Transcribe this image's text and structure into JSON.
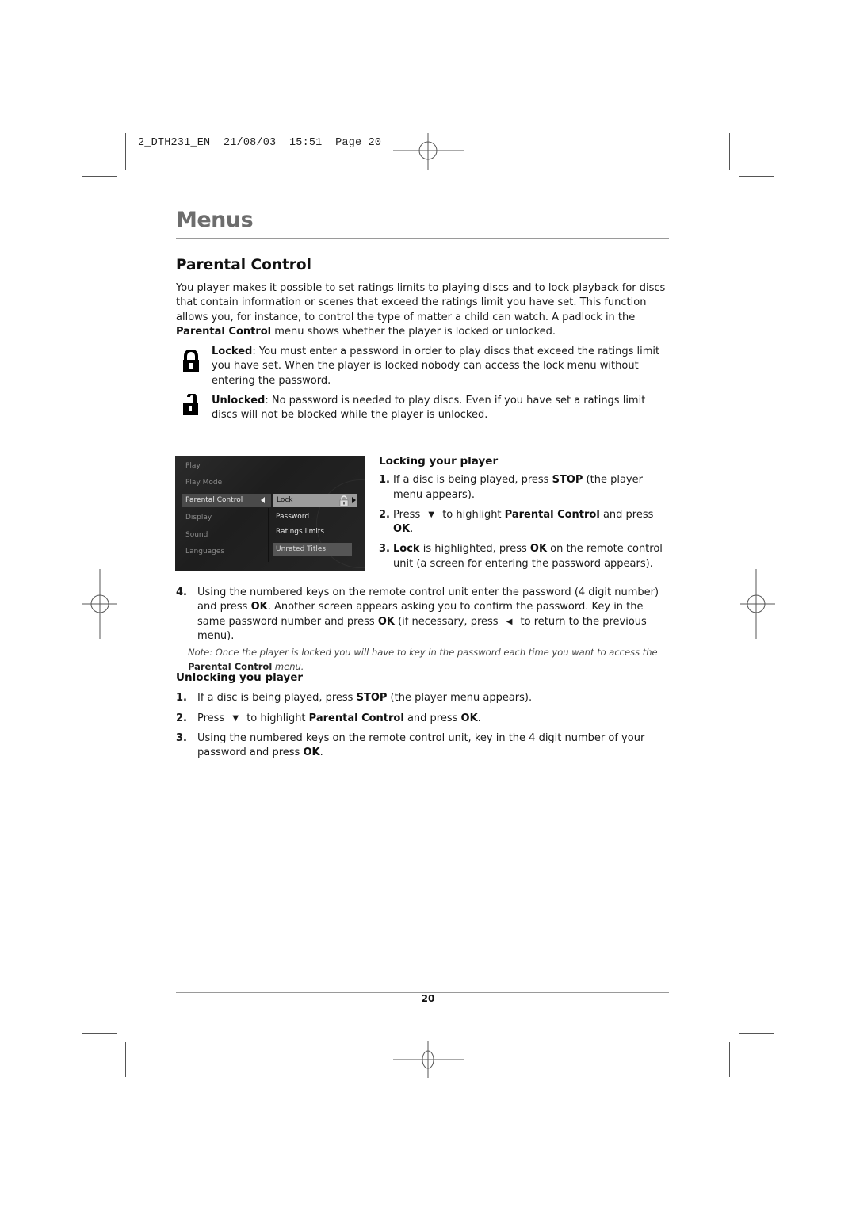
{
  "slug": {
    "file": "2_DTH231_EN",
    "date": "21/08/03",
    "time": "15:51",
    "page_label": "Page 20"
  },
  "section_title": "Menus",
  "heading": "Parental Control",
  "intro": {
    "t1": "You player makes it possible to set ratings limits to playing discs and to lock playback for discs that contain information or scenes that exceed the ratings limit you have set. This function allows you, for instance, to control the type of matter a child can watch. A padlock in the ",
    "b1": "Parental Control",
    "t2": " menu shows whether the player is locked or unlocked."
  },
  "locked": {
    "icon": "padlock-closed-icon",
    "label": "Locked",
    "text": ": You must enter a password in order to play discs that exceed the ratings limit you have set. When the player is locked nobody can access the lock menu without entering the password."
  },
  "unlocked": {
    "icon": "padlock-open-icon",
    "label": "Unlocked",
    "text": ": No password is needed to play discs. Even if you have set a ratings limit discs will not be blocked while the player is unlocked."
  },
  "tv_menu": {
    "left_items": [
      "Play",
      "Play Mode",
      "Parental Control",
      "Display",
      "Sound",
      "Languages"
    ],
    "selected_left": "Parental Control",
    "right_items": [
      "Lock",
      "Password",
      "Ratings limits",
      "Unrated Titles"
    ],
    "selected_right": "Lock"
  },
  "locking": {
    "title": "Locking your player",
    "steps": [
      {
        "num": "1.",
        "t1": "If a disc is being played, press ",
        "b1": "STOP",
        "t2": " (the player menu appears)."
      },
      {
        "num": "2.",
        "t1": "Press ",
        "arrow": "▼",
        "t2": " to highlight ",
        "b1": "Parental Control",
        "t3": " and press ",
        "b2": "OK",
        "t4": "."
      },
      {
        "num": "3.",
        "b1": "Lock",
        "t1": " is highlighted, press ",
        "b2": "OK",
        "t2": " on the remote control unit (a screen for entering the password appears)."
      },
      {
        "num": "4.",
        "t1": "Using the numbered keys on the remote control unit enter the password (4 digit number) and press ",
        "b1": "OK",
        "t2": ". Another screen appears asking you to confirm the password. Key in the same password number and press ",
        "b2": "OK",
        "t3": " (if necessary, press ",
        "arrow": "◀",
        "t4": " to return to the previous menu)."
      }
    ],
    "note": {
      "t1": "Note: Once the player is locked you will have to key in the password each time you want to access the ",
      "b1": "Parental Control",
      "t2": " menu."
    }
  },
  "unlocking": {
    "title": "Unlocking you player",
    "steps": [
      {
        "num": "1.",
        "t1": "If a disc is being played, press ",
        "b1": "STOP",
        "t2": " (the player menu appears)."
      },
      {
        "num": "2.",
        "t1": "Press ",
        "arrow": "▼",
        "t2": " to highlight ",
        "b1": "Parental Control",
        "t3": " and press ",
        "b2": "OK",
        "t4": "."
      },
      {
        "num": "3.",
        "t1": "Using the numbered keys on the remote control unit, key in the 4 digit number of your password and press ",
        "b1": "OK",
        "t2": "."
      }
    ]
  },
  "page_number": "20"
}
